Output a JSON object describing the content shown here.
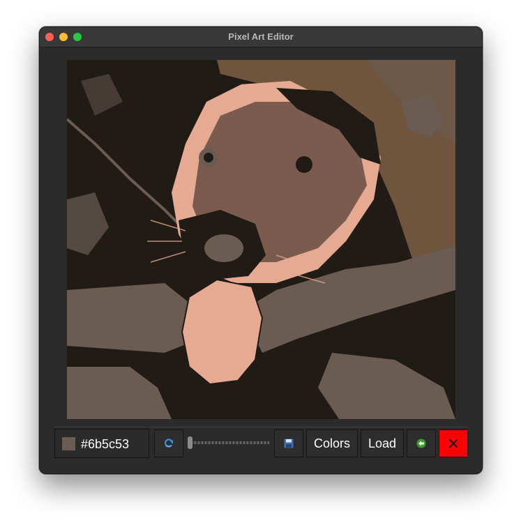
{
  "window": {
    "title": "Pixel Art Editor"
  },
  "toolbar": {
    "selected_color": {
      "label": "#6b5c53",
      "value": "#6b5c53"
    },
    "refresh_icon": "refresh-icon",
    "brush_size": {
      "level": 0.0
    },
    "save_icon": "floppy-disk-icon",
    "colors_label": "Colors",
    "load_label": "Load",
    "back_icon": "arrow-left-icon",
    "close_icon": "x-icon"
  },
  "palette": {
    "dark": "#211b16",
    "gray": "#6b5c53",
    "brown": "#6f553d",
    "pink": "#e6a992",
    "close_red": "#ff0000"
  }
}
